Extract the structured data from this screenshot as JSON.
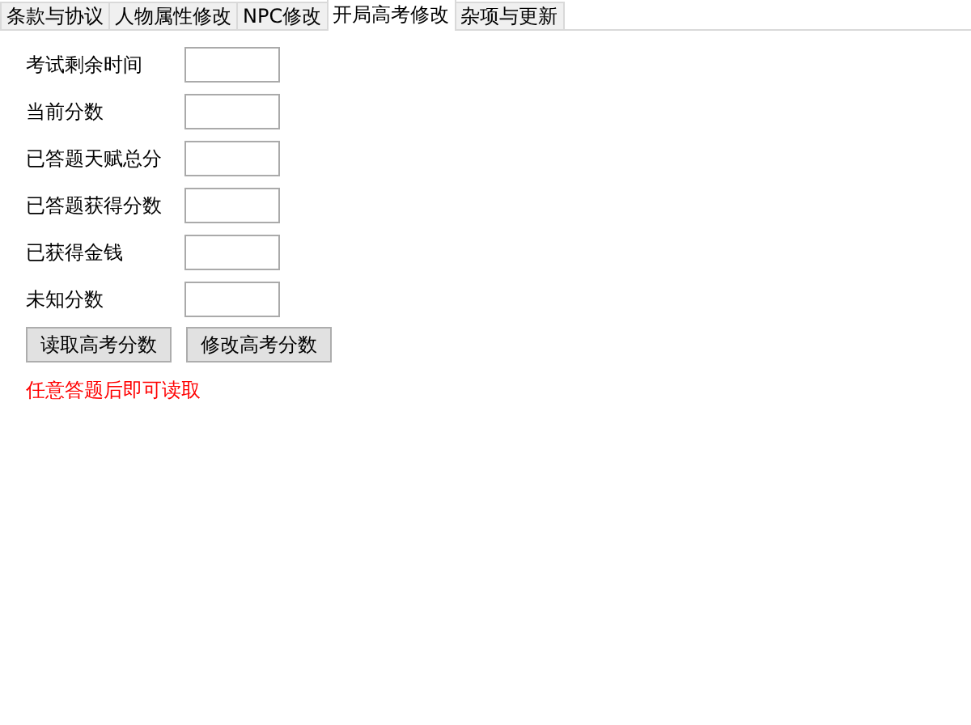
{
  "tabs": [
    {
      "label": "条款与协议",
      "selected": false
    },
    {
      "label": "人物属性修改",
      "selected": false
    },
    {
      "label": "NPC修改",
      "selected": false
    },
    {
      "label": "开局高考修改",
      "selected": true
    },
    {
      "label": "杂项与更新",
      "selected": false
    }
  ],
  "fields": [
    {
      "label": "考试剩余时间"
    },
    {
      "label": "当前分数"
    },
    {
      "label": "已答题天赋总分"
    },
    {
      "label": "已答题获得分数"
    },
    {
      "label": "已获得金钱"
    },
    {
      "label": "未知分数"
    }
  ],
  "buttons": [
    "读取高考分数",
    "修改高考分数"
  ],
  "note": "任意答题后即可读取"
}
